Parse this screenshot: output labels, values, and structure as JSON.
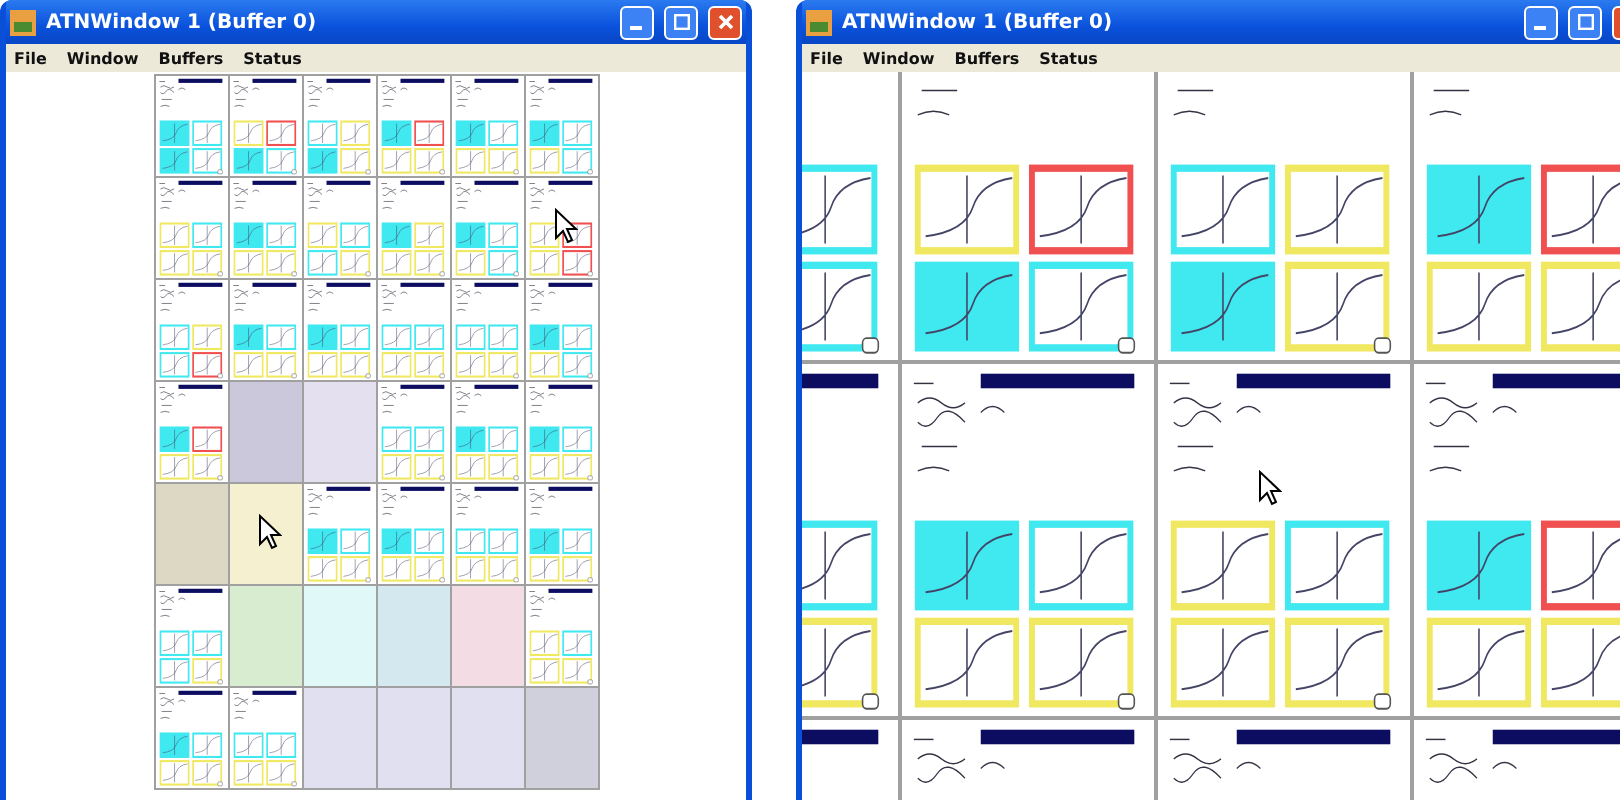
{
  "windows": [
    {
      "title": "ATNWindow 1 (Buffer 0)",
      "menu": [
        "File",
        "Window",
        "Buffers",
        "Status"
      ],
      "kind": "overview",
      "tiles": [
        {
          "kind": "page",
          "frames": [
            {
              "color": "#40e8f0",
              "filled": true
            },
            {
              "color": "#40e8f0",
              "filled": false
            },
            {
              "color": "#40e8f0",
              "filled": true
            },
            {
              "color": "#40e8f0",
              "filled": false
            }
          ]
        },
        {
          "kind": "page",
          "frames": [
            {
              "color": "#f0e860",
              "filled": false
            },
            {
              "color": "#f05050",
              "filled": false
            },
            {
              "color": "#40e8f0",
              "filled": true
            },
            {
              "color": "#40e8f0",
              "filled": false
            }
          ]
        },
        {
          "kind": "page",
          "frames": [
            {
              "color": "#40e8f0",
              "filled": false
            },
            {
              "color": "#f0e860",
              "filled": false
            },
            {
              "color": "#40e8f0",
              "filled": true
            },
            {
              "color": "#f0e860",
              "filled": false
            }
          ]
        },
        {
          "kind": "page",
          "frames": [
            {
              "color": "#40e8f0",
              "filled": true
            },
            {
              "color": "#f05050",
              "filled": false
            },
            {
              "color": "#f0e860",
              "filled": false
            },
            {
              "color": "#f0e860",
              "filled": false
            }
          ]
        },
        {
          "kind": "page",
          "frames": [
            {
              "color": "#40e8f0",
              "filled": true
            },
            {
              "color": "#40e8f0",
              "filled": false
            },
            {
              "color": "#f0e860",
              "filled": false
            },
            {
              "color": "#f0e860",
              "filled": false
            }
          ]
        },
        {
          "kind": "page",
          "frames": [
            {
              "color": "#40e8f0",
              "filled": true
            },
            {
              "color": "#40e8f0",
              "filled": false
            },
            {
              "color": "#f0e860",
              "filled": false
            },
            {
              "color": "#40e8f0",
              "filled": false
            }
          ]
        },
        {
          "kind": "page",
          "frames": [
            {
              "color": "#f0e860",
              "filled": false
            },
            {
              "color": "#40e8f0",
              "filled": false
            },
            {
              "color": "#f0e860",
              "filled": false
            },
            {
              "color": "#f0e860",
              "filled": false
            }
          ]
        },
        {
          "kind": "page",
          "frames": [
            {
              "color": "#40e8f0",
              "filled": true
            },
            {
              "color": "#40e8f0",
              "filled": false
            },
            {
              "color": "#f0e860",
              "filled": false
            },
            {
              "color": "#f0e860",
              "filled": false
            }
          ]
        },
        {
          "kind": "page",
          "frames": [
            {
              "color": "#f0e860",
              "filled": false
            },
            {
              "color": "#40e8f0",
              "filled": false
            },
            {
              "color": "#40e8f0",
              "filled": false
            },
            {
              "color": "#f0e860",
              "filled": false
            }
          ]
        },
        {
          "kind": "page",
          "frames": [
            {
              "color": "#40e8f0",
              "filled": true
            },
            {
              "color": "#f0e860",
              "filled": false
            },
            {
              "color": "#f0e860",
              "filled": false
            },
            {
              "color": "#f0e860",
              "filled": false
            }
          ]
        },
        {
          "kind": "page",
          "frames": [
            {
              "color": "#40e8f0",
              "filled": true
            },
            {
              "color": "#40e8f0",
              "filled": false
            },
            {
              "color": "#f0e860",
              "filled": false
            },
            {
              "color": "#40e8f0",
              "filled": false
            }
          ]
        },
        {
          "kind": "page",
          "frames": [
            {
              "color": "#f0e860",
              "filled": false
            },
            {
              "color": "#f05050",
              "filled": false
            },
            {
              "color": "#f0e860",
              "filled": false
            },
            {
              "color": "#f05050",
              "filled": false
            }
          ],
          "pointer": true
        },
        {
          "kind": "page",
          "frames": [
            {
              "color": "#40e8f0",
              "filled": false
            },
            {
              "color": "#f0e860",
              "filled": false
            },
            {
              "color": "#40e8f0",
              "filled": false
            },
            {
              "color": "#f05050",
              "filled": false
            }
          ]
        },
        {
          "kind": "page",
          "frames": [
            {
              "color": "#40e8f0",
              "filled": true
            },
            {
              "color": "#40e8f0",
              "filled": false
            },
            {
              "color": "#f0e860",
              "filled": false
            },
            {
              "color": "#f0e860",
              "filled": false
            }
          ]
        },
        {
          "kind": "page",
          "frames": [
            {
              "color": "#40e8f0",
              "filled": true
            },
            {
              "color": "#40e8f0",
              "filled": false
            },
            {
              "color": "#f0e860",
              "filled": false
            },
            {
              "color": "#f0e860",
              "filled": false
            }
          ]
        },
        {
          "kind": "page",
          "frames": [
            {
              "color": "#40e8f0",
              "filled": false
            },
            {
              "color": "#40e8f0",
              "filled": false
            },
            {
              "color": "#f0e860",
              "filled": false
            },
            {
              "color": "#f0e860",
              "filled": false
            }
          ]
        },
        {
          "kind": "page",
          "frames": [
            {
              "color": "#40e8f0",
              "filled": false
            },
            {
              "color": "#40e8f0",
              "filled": false
            },
            {
              "color": "#f0e860",
              "filled": false
            },
            {
              "color": "#f0e860",
              "filled": false
            }
          ]
        },
        {
          "kind": "page",
          "frames": [
            {
              "color": "#40e8f0",
              "filled": true
            },
            {
              "color": "#40e8f0",
              "filled": false
            },
            {
              "color": "#f0e860",
              "filled": false
            },
            {
              "color": "#40e8f0",
              "filled": false
            }
          ]
        },
        {
          "kind": "page",
          "frames": [
            {
              "color": "#40e8f0",
              "filled": true
            },
            {
              "color": "#f05050",
              "filled": false
            },
            {
              "color": "#f0e860",
              "filled": false
            },
            {
              "color": "#f0e860",
              "filled": false
            }
          ]
        },
        {
          "kind": "blank",
          "color": "#ccc8dc"
        },
        {
          "kind": "blank",
          "color": "#e4e0f0"
        },
        {
          "kind": "page",
          "frames": [
            {
              "color": "#40e8f0",
              "filled": false
            },
            {
              "color": "#40e8f0",
              "filled": false
            },
            {
              "color": "#f0e860",
              "filled": false
            },
            {
              "color": "#f0e860",
              "filled": false
            }
          ]
        },
        {
          "kind": "page",
          "frames": [
            {
              "color": "#40e8f0",
              "filled": true
            },
            {
              "color": "#40e8f0",
              "filled": false
            },
            {
              "color": "#f0e860",
              "filled": false
            },
            {
              "color": "#f0e860",
              "filled": false
            }
          ]
        },
        {
          "kind": "page",
          "frames": [
            {
              "color": "#40e8f0",
              "filled": true
            },
            {
              "color": "#40e8f0",
              "filled": false
            },
            {
              "color": "#f0e860",
              "filled": false
            },
            {
              "color": "#f0e860",
              "filled": false
            }
          ]
        },
        {
          "kind": "blank",
          "color": "#ddd8c4"
        },
        {
          "kind": "blank",
          "color": "#f4f0d0",
          "pointer": true
        },
        {
          "kind": "page",
          "frames": [
            {
              "color": "#40e8f0",
              "filled": true
            },
            {
              "color": "#40e8f0",
              "filled": false
            },
            {
              "color": "#f0e860",
              "filled": false
            },
            {
              "color": "#f0e860",
              "filled": false
            }
          ]
        },
        {
          "kind": "page",
          "frames": [
            {
              "color": "#40e8f0",
              "filled": true
            },
            {
              "color": "#40e8f0",
              "filled": false
            },
            {
              "color": "#f0e860",
              "filled": false
            },
            {
              "color": "#f0e860",
              "filled": false
            }
          ]
        },
        {
          "kind": "page",
          "frames": [
            {
              "color": "#40e8f0",
              "filled": false
            },
            {
              "color": "#40e8f0",
              "filled": false
            },
            {
              "color": "#f0e860",
              "filled": false
            },
            {
              "color": "#f0e860",
              "filled": false
            }
          ]
        },
        {
          "kind": "page",
          "frames": [
            {
              "color": "#40e8f0",
              "filled": true
            },
            {
              "color": "#40e8f0",
              "filled": false
            },
            {
              "color": "#f0e860",
              "filled": false
            },
            {
              "color": "#f0e860",
              "filled": false
            }
          ]
        },
        {
          "kind": "page",
          "frames": [
            {
              "color": "#40e8f0",
              "filled": false
            },
            {
              "color": "#40e8f0",
              "filled": false
            },
            {
              "color": "#40e8f0",
              "filled": false
            },
            {
              "color": "#f0e860",
              "filled": false
            }
          ]
        },
        {
          "kind": "blank",
          "color": "#d8ecd0"
        },
        {
          "kind": "blank",
          "color": "#e0f8f8"
        },
        {
          "kind": "blank",
          "color": "#d4e8f0"
        },
        {
          "kind": "blank",
          "color": "#f4dce4"
        },
        {
          "kind": "page",
          "frames": [
            {
              "color": "#f0e860",
              "filled": false
            },
            {
              "color": "#40e8f0",
              "filled": false
            },
            {
              "color": "#f0e860",
              "filled": false
            },
            {
              "color": "#f0e860",
              "filled": false
            }
          ]
        },
        {
          "kind": "page",
          "frames": [
            {
              "color": "#40e8f0",
              "filled": true
            },
            {
              "color": "#40e8f0",
              "filled": false
            },
            {
              "color": "#f0e860",
              "filled": false
            },
            {
              "color": "#f0e860",
              "filled": false
            }
          ]
        },
        {
          "kind": "page",
          "frames": [
            {
              "color": "#40e8f0",
              "filled": false
            },
            {
              "color": "#40e8f0",
              "filled": false
            },
            {
              "color": "#f0e860",
              "filled": false
            },
            {
              "color": "#f0e860",
              "filled": false
            }
          ]
        },
        {
          "kind": "blank",
          "color": "#e0e0f0"
        },
        {
          "kind": "blank",
          "color": "#e0e0f0"
        },
        {
          "kind": "blank",
          "color": "#e0e0f0"
        },
        {
          "kind": "blank",
          "color": "#d0d0dc"
        }
      ]
    },
    {
      "title": "ATNWindow 1 (Buffer 0)",
      "menu": [
        "File",
        "Window",
        "Buffers",
        "Status"
      ],
      "kind": "zoomed",
      "tiles": [
        {
          "kind": "page_cut",
          "frames": [
            {
              "color": "#40e8f0",
              "filled": false
            },
            {
              "color": "#40e8f0",
              "filled": false
            }
          ]
        },
        {
          "kind": "page",
          "frames": [
            {
              "color": "#f0e860",
              "filled": false
            },
            {
              "color": "#f05050",
              "filled": false
            },
            {
              "color": "#40e8f0",
              "filled": true
            },
            {
              "color": "#40e8f0",
              "filled": false
            }
          ]
        },
        {
          "kind": "page",
          "frames": [
            {
              "color": "#40e8f0",
              "filled": false
            },
            {
              "color": "#f0e860",
              "filled": false
            },
            {
              "color": "#40e8f0",
              "filled": true
            },
            {
              "color": "#f0e860",
              "filled": false
            }
          ]
        },
        {
          "kind": "page",
          "frames": [
            {
              "color": "#40e8f0",
              "filled": true
            },
            {
              "color": "#f05050",
              "filled": false
            },
            {
              "color": "#f0e860",
              "filled": false
            },
            {
              "color": "#f0e860",
              "filled": false
            }
          ]
        },
        {
          "kind": "page_cut",
          "frames": [
            {
              "color": "#40e8f0",
              "filled": false
            },
            {
              "color": "#f0e860",
              "filled": false
            }
          ]
        },
        {
          "kind": "page",
          "frames": [
            {
              "color": "#40e8f0",
              "filled": true
            },
            {
              "color": "#40e8f0",
              "filled": false
            },
            {
              "color": "#f0e860",
              "filled": false
            },
            {
              "color": "#f0e860",
              "filled": false
            }
          ]
        },
        {
          "kind": "page",
          "frames": [
            {
              "color": "#f0e860",
              "filled": false
            },
            {
              "color": "#40e8f0",
              "filled": false
            },
            {
              "color": "#f0e860",
              "filled": false
            },
            {
              "color": "#f0e860",
              "filled": false
            }
          ],
          "pointer": true
        },
        {
          "kind": "page",
          "frames": [
            {
              "color": "#40e8f0",
              "filled": true
            },
            {
              "color": "#f05050",
              "filled": false
            },
            {
              "color": "#f0e860",
              "filled": false
            },
            {
              "color": "#f0e860",
              "filled": false
            }
          ]
        },
        {
          "kind": "page_cut"
        },
        {
          "kind": "page"
        },
        {
          "kind": "page"
        },
        {
          "kind": "page"
        }
      ]
    }
  ]
}
